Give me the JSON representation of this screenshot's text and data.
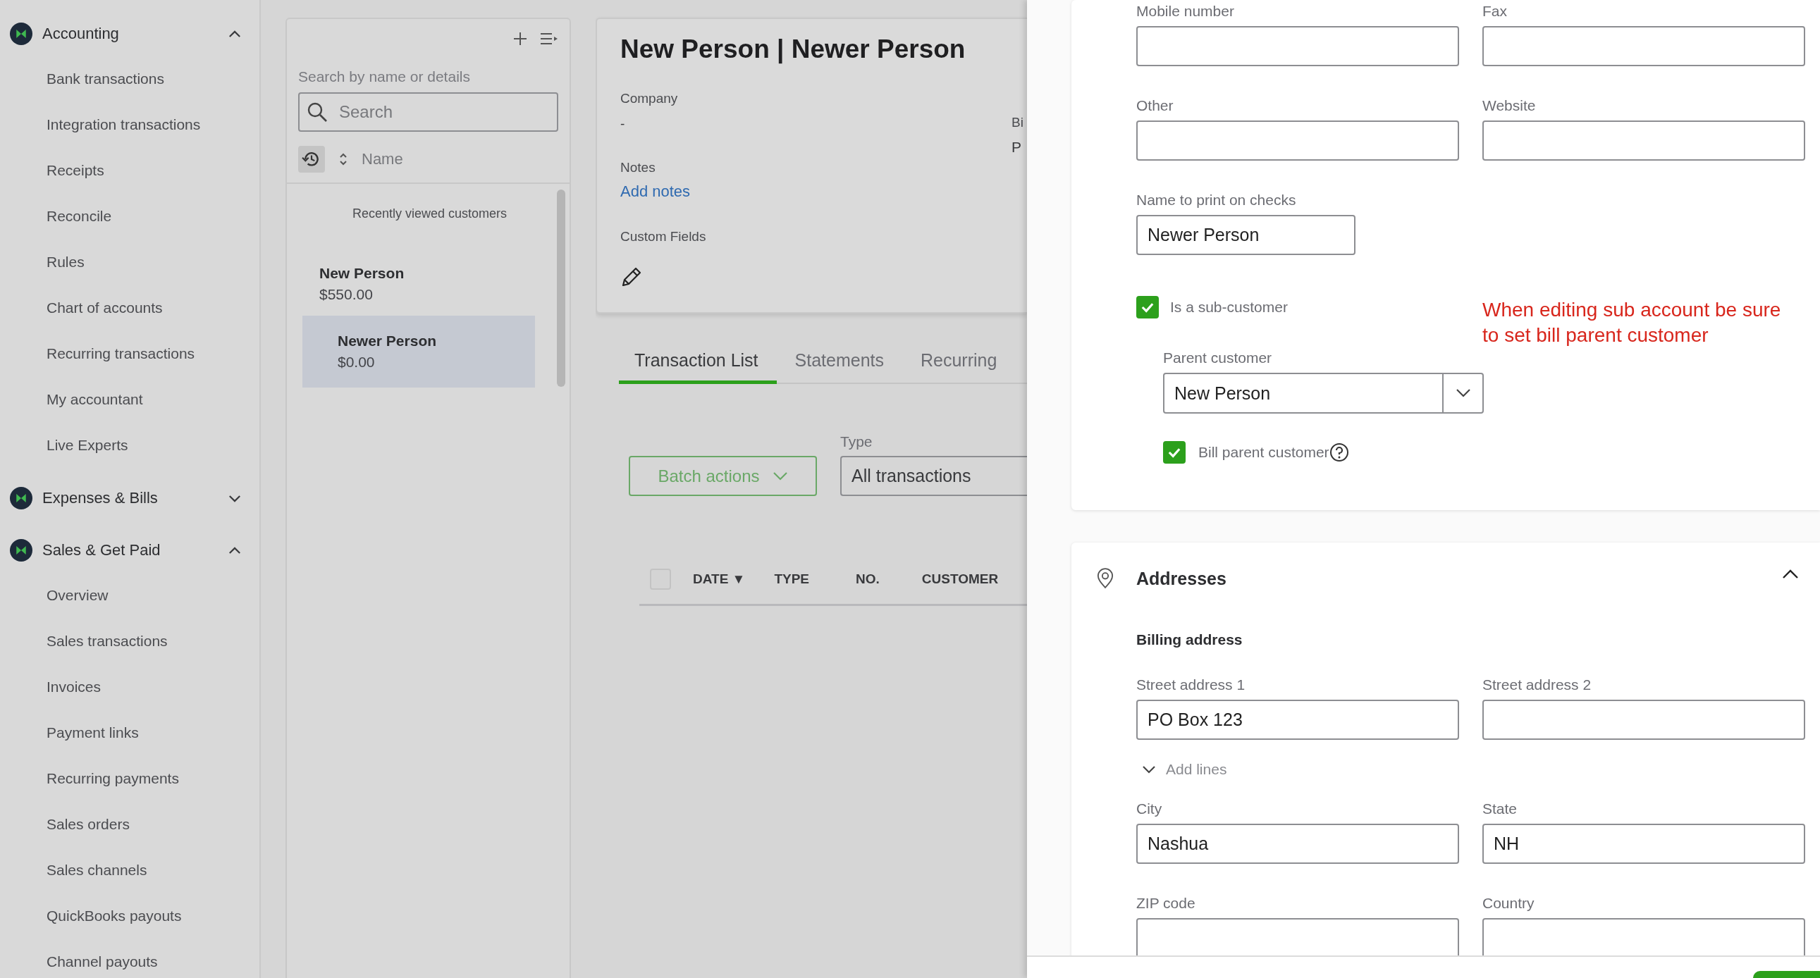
{
  "sidebar": {
    "sections": [
      {
        "label": "Accounting",
        "expanded": true,
        "items": [
          "Bank transactions",
          "Integration transactions",
          "Receipts",
          "Reconcile",
          "Rules",
          "Chart of accounts",
          "Recurring transactions",
          "My accountant",
          "Live Experts"
        ]
      },
      {
        "label": "Expenses & Bills",
        "expanded": false
      },
      {
        "label": "Sales & Get Paid",
        "expanded": true,
        "items": [
          "Overview",
          "Sales transactions",
          "Invoices",
          "Payment links",
          "Recurring payments",
          "Sales orders",
          "Sales channels",
          "QuickBooks payouts",
          "Channel payouts"
        ]
      }
    ]
  },
  "customer_list": {
    "search_label": "Search by name or details",
    "search": {
      "placeholder": "Search"
    },
    "sort_label": "Name",
    "recent_heading": "Recently viewed customers",
    "customers": [
      {
        "name": "New Person",
        "balance": "$550.00",
        "selected": false
      },
      {
        "name": "Newer Person",
        "balance": "$0.00",
        "selected": true
      }
    ]
  },
  "customer_detail": {
    "title": "New Person | Newer Person",
    "company": {
      "label": "Company",
      "value": "-"
    },
    "notes": {
      "label": "Notes",
      "link": "Add notes"
    },
    "custom_fields": {
      "label": "Custom Fields"
    },
    "column_2": {
      "label": "Bi",
      "value": "P"
    }
  },
  "tabs": [
    {
      "label": "Transaction List",
      "selected": true
    },
    {
      "label": "Statements",
      "selected": false
    },
    {
      "label": "Recurring",
      "selected": false
    }
  ],
  "batch_actions": "Batch actions",
  "type_filter": {
    "label": "Type",
    "value": "All transactions"
  },
  "table": {
    "select_all": false,
    "columns": [
      "DATE ▼",
      "TYPE",
      "NO.",
      "CUSTOMER"
    ]
  },
  "drawer": {
    "contact_rows": [
      [
        {
          "label": "Mobile number"
        },
        {
          "label": "Fax"
        }
      ],
      [
        {
          "label": "Other"
        },
        {
          "label": "Website"
        }
      ]
    ],
    "print_name": {
      "label": "Name to print on checks",
      "value": "Newer Person"
    },
    "sub_customer": {
      "label": "Is a sub-customer",
      "checked": true
    },
    "parent_customer": {
      "label": "Parent customer",
      "value": "New Person"
    },
    "bill_parent": {
      "label": "Bill parent customer",
      "checked": true
    },
    "annotation": "When editing sub account be sure\nto set bill parent customer",
    "addresses": {
      "title": "Addresses",
      "expanded": true,
      "billing_heading": "Billing address",
      "rows": [
        [
          {
            "label": "Street address 1",
            "value": "PO Box 123"
          },
          {
            "label": "Street address 2"
          }
        ]
      ],
      "add_lines": {
        "label": "Add lines",
        "expanded": false
      },
      "rows_2": [
        [
          {
            "label": "City",
            "value": "Nashua"
          },
          {
            "label": "State",
            "value": "NH"
          }
        ],
        [
          {
            "label": "ZIP code"
          },
          {
            "label": "Country"
          }
        ]
      ]
    }
  }
}
